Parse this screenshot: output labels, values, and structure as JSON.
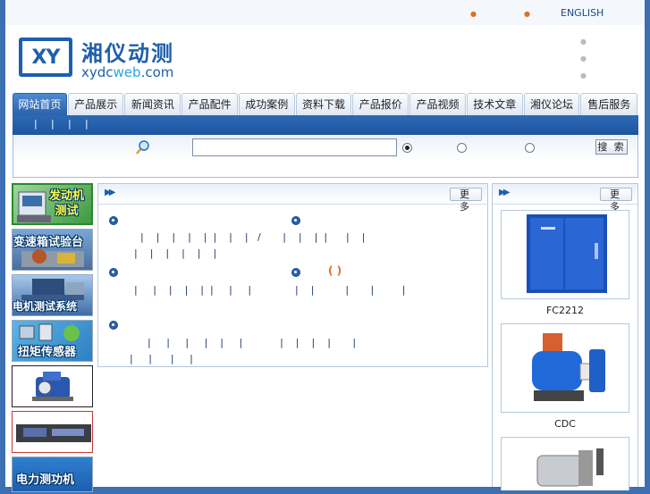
{
  "header": {
    "english_link": "ENGLISH",
    "logo_mark": "XY",
    "logo_cn": "湘仪动测",
    "logo_en_a": "xydc",
    "logo_en_b": "web",
    "logo_en_c": ".com"
  },
  "nav": {
    "tabs": [
      "网站首页",
      "产品展示",
      "新闻资讯",
      "产品配件",
      "成功案例",
      "资料下载",
      "产品报价",
      "产品视频",
      "技术文章",
      "湘仪论坛",
      "售后服务"
    ]
  },
  "search": {
    "button_label": "搜 索",
    "input_value": ""
  },
  "left": {
    "items": [
      {
        "caption": "发动机\n测试"
      },
      {
        "caption": "变速箱试验台"
      },
      {
        "caption": "电机测试系统"
      },
      {
        "caption": "扭矩传感器"
      },
      {
        "caption": ""
      },
      {
        "caption": ""
      },
      {
        "caption": "电力测功机"
      }
    ]
  },
  "news": {
    "more_label": "更 多",
    "paren": "(   )"
  },
  "products": {
    "more_label": "更 多",
    "items": [
      {
        "name": "FC2212"
      },
      {
        "name": "CDC"
      },
      {
        "name": ""
      }
    ]
  },
  "colors": {
    "brand": "#1d5fae",
    "accent": "#e07020",
    "nav_active": "#2a62ab"
  }
}
